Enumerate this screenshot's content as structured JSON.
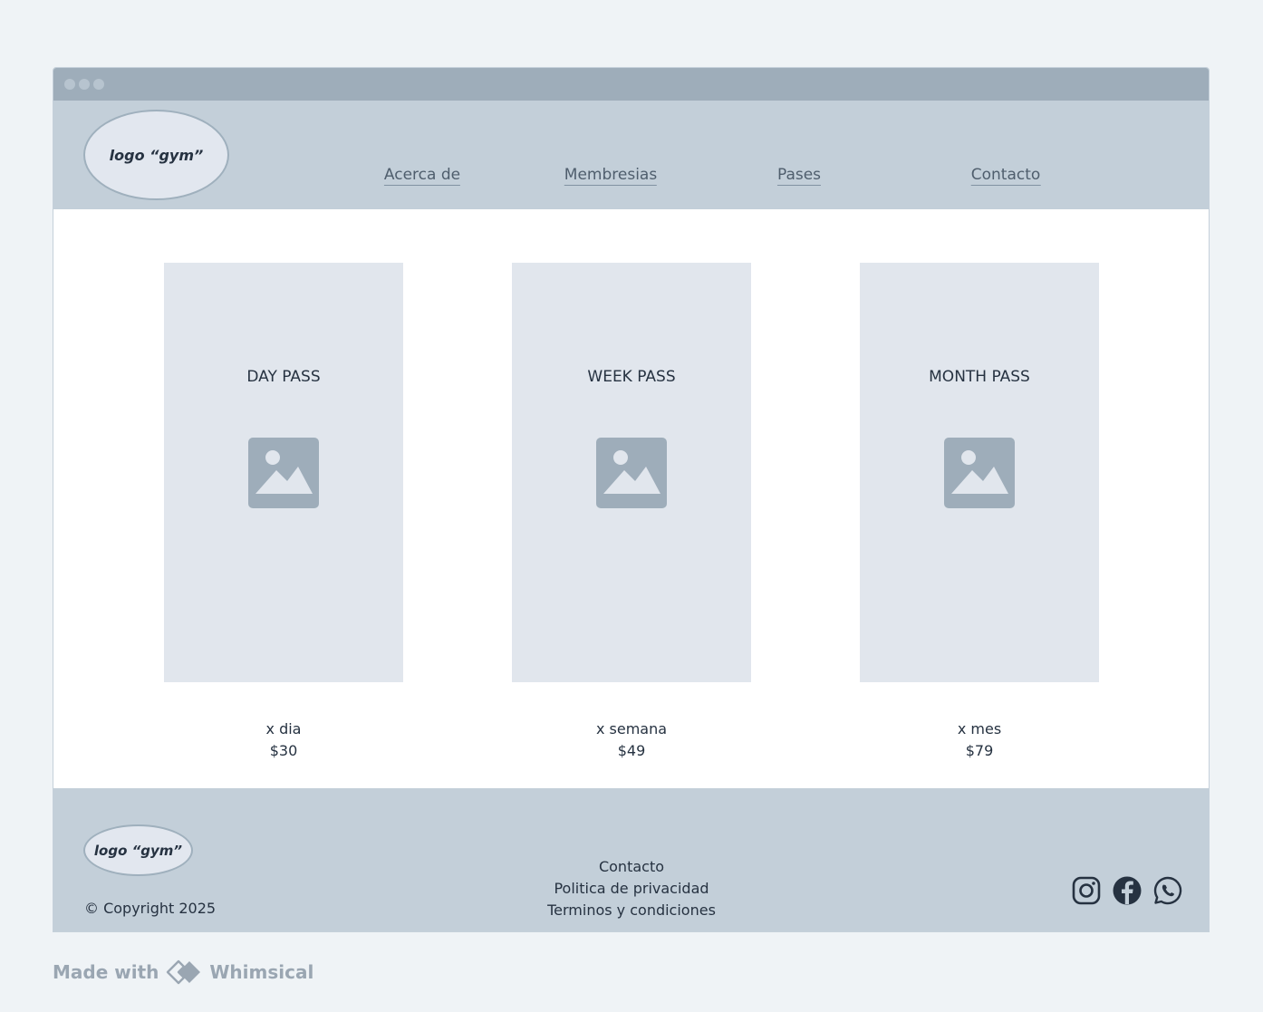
{
  "header": {
    "logo_text": "logo “gym”",
    "nav": [
      {
        "label": "Acerca de"
      },
      {
        "label": "Membresias"
      },
      {
        "label": "Pases"
      },
      {
        "label": "Contacto"
      }
    ]
  },
  "passes": [
    {
      "title": "DAY PASS",
      "period": "x dia",
      "price": "$30",
      "image_icon": "image-placeholder-icon"
    },
    {
      "title": "WEEK PASS",
      "period": "x semana",
      "price": "$49",
      "image_icon": "image-placeholder-icon"
    },
    {
      "title": "MONTH PASS",
      "period": "x mes",
      "price": "$79",
      "image_icon": "image-placeholder-icon"
    }
  ],
  "footer": {
    "logo_text": "logo “gym”",
    "copyright": "© Copyright 2025",
    "links": [
      {
        "label": "Contacto"
      },
      {
        "label": "Politica de privacidad"
      },
      {
        "label": "Terminos y condiciones"
      }
    ],
    "social_icons": [
      "instagram-icon",
      "facebook-icon",
      "whatsapp-icon"
    ]
  },
  "branding": {
    "made_with": "Made with",
    "brand": "Whimsical"
  },
  "colors": {
    "page_background": "#eff3f6",
    "titlebar": "#9eadba",
    "header_footer": "#c3cfd9",
    "card": "#e1e6ed",
    "text": "#263241",
    "link": "#4f5e6d",
    "icon": "#9eadba"
  }
}
